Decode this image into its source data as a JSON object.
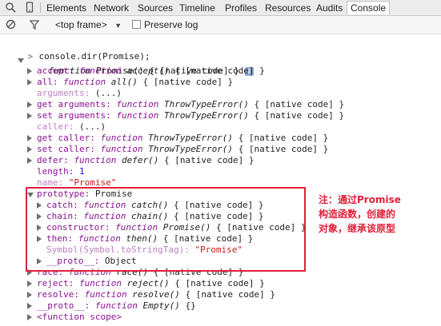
{
  "toolbar": {
    "tabs": [
      "Elements",
      "Network",
      "Sources",
      "Timeline",
      "Profiles",
      "Resources",
      "Audits",
      "Console"
    ],
    "active_tab": "Console"
  },
  "filterbar": {
    "frame_label": "<top frame>",
    "preserve_log_label": "Preserve log"
  },
  "console": {
    "prompt_symbol": ">",
    "command": "console.dir(Promise);",
    "root": {
      "kw": "function",
      "rest": " Promise() { [native code] }",
      "info": "i"
    },
    "props": [
      {
        "name": "accept:",
        "kw": "function",
        "sig": "accept()",
        "tail": "{ [native code] }"
      },
      {
        "name": "all:",
        "kw": "function",
        "sig": "all()",
        "tail": "{ [native code] }"
      },
      {
        "name": "arguments:",
        "text": "(...)"
      },
      {
        "name": "get arguments:",
        "kw": "function",
        "sig": "ThrowTypeError()",
        "tail": "{ [native code] }"
      },
      {
        "name": "set arguments:",
        "kw": "function",
        "sig": "ThrowTypeError()",
        "tail": "{ [native code] }"
      },
      {
        "name": "caller:",
        "text": "(...)"
      },
      {
        "name": "get caller:",
        "kw": "function",
        "sig": "ThrowTypeError()",
        "tail": "{ [native code] }"
      },
      {
        "name": "set caller:",
        "kw": "function",
        "sig": "ThrowTypeError()",
        "tail": "{ [native code] }"
      },
      {
        "name": "defer:",
        "kw": "function",
        "sig": "defer()",
        "tail": "{ [native code] }"
      },
      {
        "name": "length:",
        "value": "1"
      },
      {
        "name": "name:",
        "value": "\"Promise\""
      }
    ],
    "prototype": {
      "name": "prototype:",
      "value": "Promise",
      "items": [
        {
          "name": "catch:",
          "kw": "function",
          "sig": "catch()",
          "tail": "{ [native code] }"
        },
        {
          "name": "chain:",
          "kw": "function",
          "sig": "chain()",
          "tail": "{ [native code] }"
        },
        {
          "name": "constructor:",
          "kw": "function",
          "sig": "Promise()",
          "tail": "{ [native code] }"
        },
        {
          "name": "then:",
          "kw": "function",
          "sig": "then()",
          "tail": "{ [native code] }"
        },
        {
          "name": "Symbol(Symbol.toStringTag):",
          "value": "\"Promise\""
        },
        {
          "name": "__proto__:",
          "value": "Object"
        }
      ]
    },
    "props_after": [
      {
        "name": "race:",
        "kw": "function",
        "sig": "race()",
        "tail": "{ [native code] }"
      },
      {
        "name": "reject:",
        "kw": "function",
        "sig": "reject()",
        "tail": "{ [native code] }"
      },
      {
        "name": "resolve:",
        "kw": "function",
        "sig": "resolve()",
        "tail": "{ [native code] }"
      },
      {
        "name": "__proto__:",
        "kw": "function",
        "sig": "Empty()",
        "tail": "{}"
      },
      {
        "name": "<function scope>"
      }
    ]
  },
  "annotation": {
    "lines": [
      "注：通过Promise",
      "构造函数，创建的",
      "对象，继承该原型"
    ],
    "color": "#e0203a"
  }
}
